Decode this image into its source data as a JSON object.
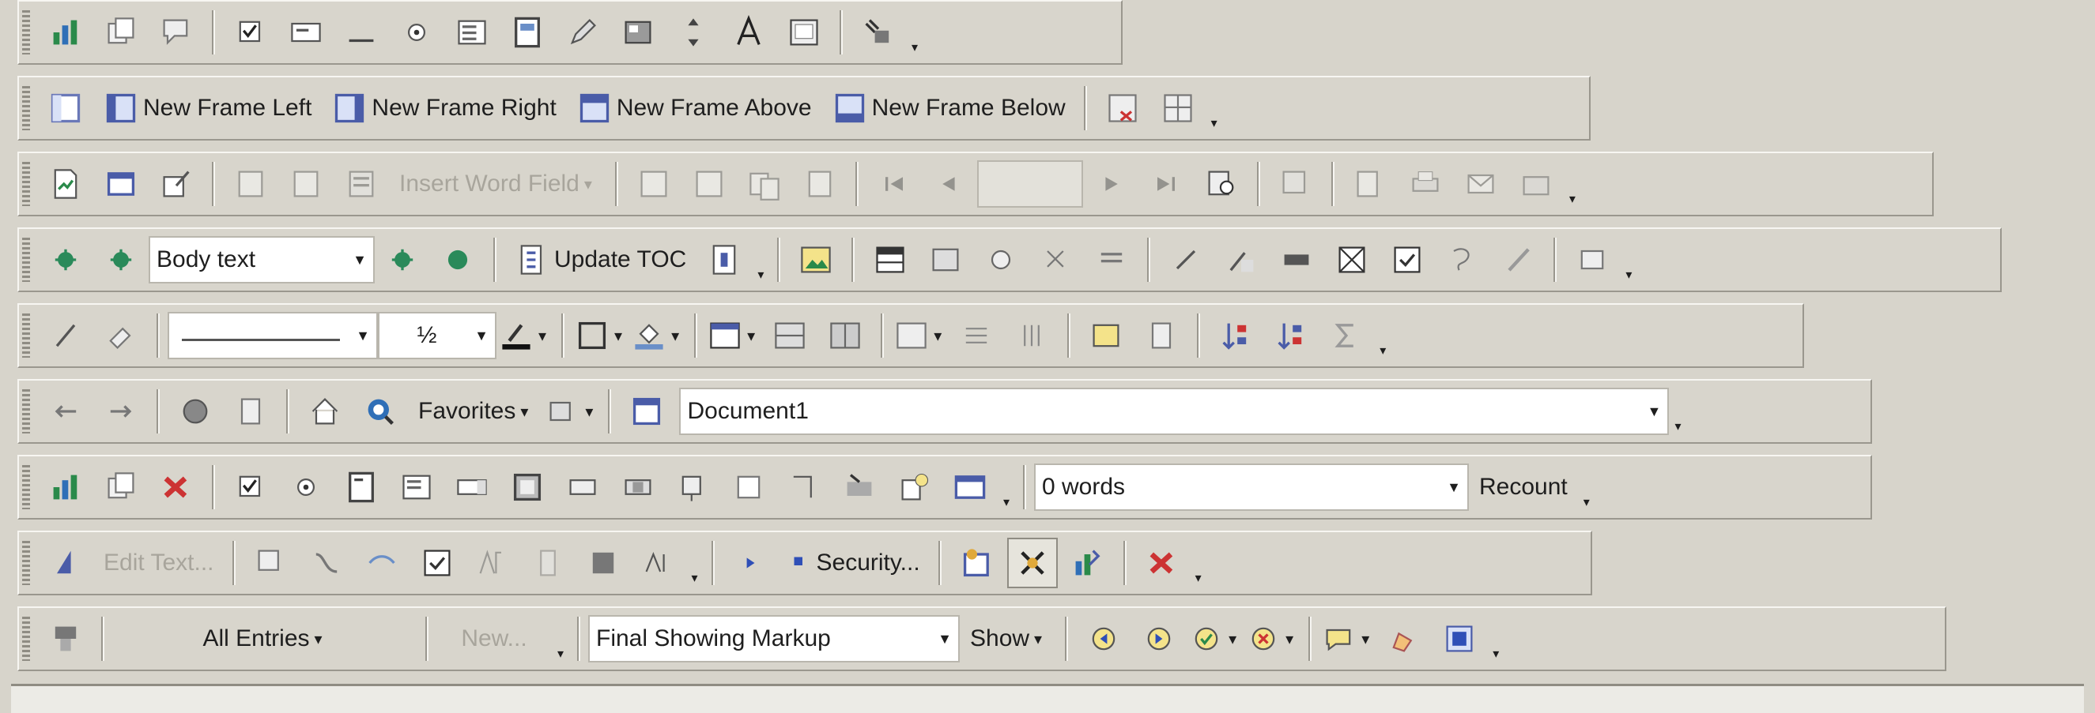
{
  "frames": {
    "new_left": "New Frame Left",
    "new_right": "New Frame Right",
    "new_above": "New Frame Above",
    "new_below": "New Frame Below"
  },
  "mail_merge": {
    "insert_word_field": "Insert Word Field"
  },
  "outlining": {
    "style_value": "Body text",
    "update_toc": "Update TOC"
  },
  "tables": {
    "line_weight": "½"
  },
  "web": {
    "favorites": "Favorites",
    "address": "Document1"
  },
  "word_count": {
    "value": "0 words",
    "recount": "Recount"
  },
  "visual_basic": {
    "edit_text": "Edit Text...",
    "security": "Security..."
  },
  "reviewing": {
    "all_entries": "All Entries",
    "new": "New...",
    "display": "Final Showing Markup",
    "show": "Show"
  }
}
